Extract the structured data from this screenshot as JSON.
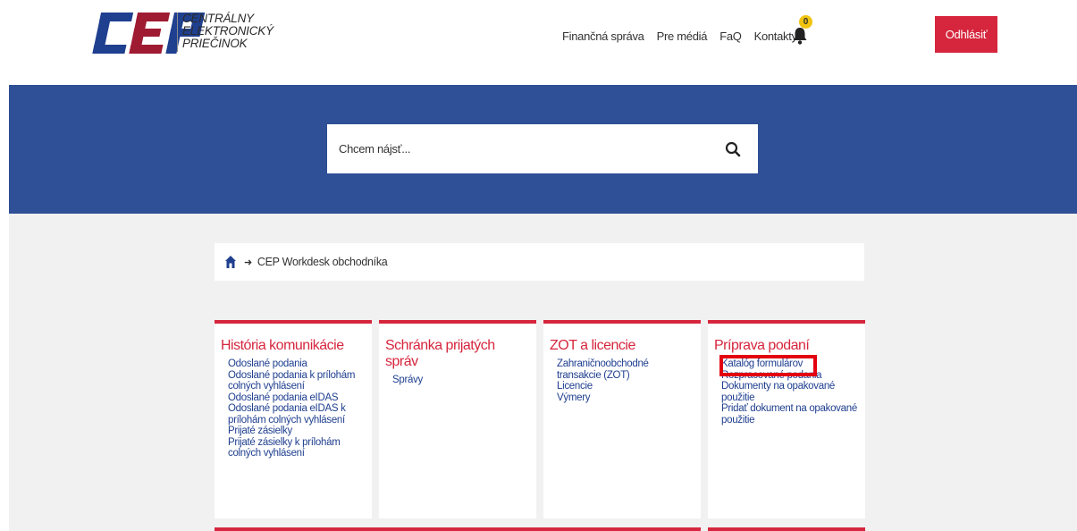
{
  "header": {
    "logo": {
      "letters": "CEP",
      "line1": "CENTRÁLNY",
      "line2": "ELEKTRONICKÝ",
      "line3": "PRIEČINOK"
    },
    "nav": [
      "Finančná správa",
      "Pre médiá",
      "FaQ",
      "Kontakty"
    ],
    "notification_count": "0",
    "logout_label": "Odhlásiť"
  },
  "search": {
    "placeholder": "Chcem nájsť..."
  },
  "breadcrumb": {
    "current": "CEP Workdesk obchodníka"
  },
  "cards": [
    {
      "title": "História komunikácie",
      "links": [
        "Odoslané podania",
        "Odoslané podania k prílohám colných vyhlásení",
        "Odoslané podania eIDAS",
        "Odoslané podania eIDAS k prílohám colných vyhlásení",
        "Prijaté zásielky",
        "Prijaté zásielky k prílohám colných vyhlásení"
      ]
    },
    {
      "title": "Schránka prijatých správ",
      "links": [
        "Správy"
      ]
    },
    {
      "title": "ZOT a licencie",
      "links": [
        "Zahraničnoobchodné transakcie (ZOT)",
        "Licencie",
        "Výmery"
      ]
    },
    {
      "title": "Príprava podaní",
      "links": [
        "Katalóg formulárov",
        "Rozpracované podania",
        "Dokumenty na opakované použitie",
        "Pridať dokument na opakované použitie"
      ]
    }
  ],
  "colors": {
    "brand_blue": "#2f4f96",
    "accent_red": "#d6263d",
    "link_blue": "#1f3f8f",
    "badge_yellow": "#f1c40f"
  }
}
